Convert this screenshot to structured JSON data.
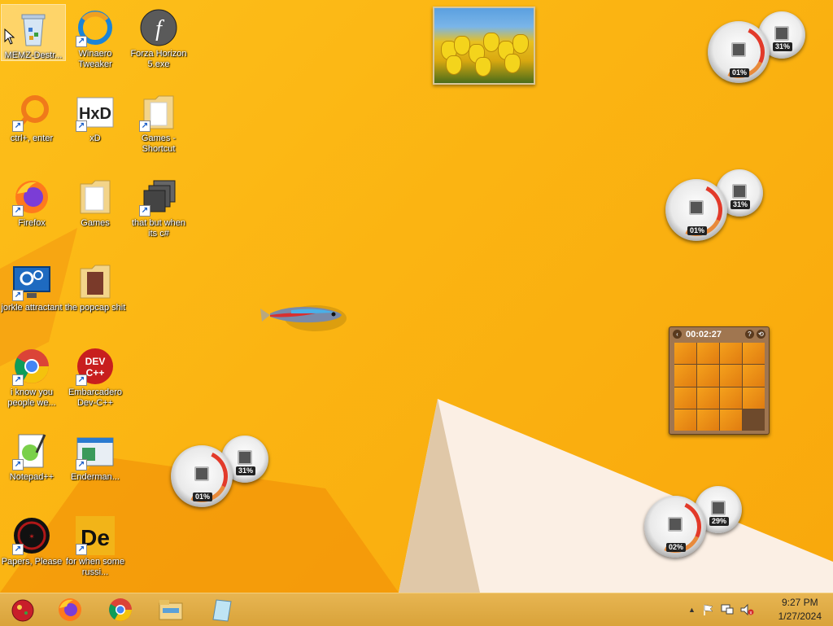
{
  "desktop": {
    "icons": [
      {
        "label": "MEMZ-Destr...",
        "icon": "recycle-bin-icon"
      },
      {
        "label": "Winaero Tweaker",
        "icon": "winaero-tweaker-icon"
      },
      {
        "label": "Forza Horizon 5.exe",
        "icon": "flash-icon"
      },
      {
        "label": "ctrl+, enter",
        "icon": "magnifier-icon"
      },
      {
        "label": "xD",
        "icon": "hxd-icon"
      },
      {
        "label": "Games - Shortcut",
        "icon": "folder-icon"
      },
      {
        "label": "Firefox",
        "icon": "firefox-icon"
      },
      {
        "label": "Games",
        "icon": "folder-icon"
      },
      {
        "label": "that but when its c#",
        "icon": "stack-icon"
      },
      {
        "label": "jorkle attractant",
        "icon": "settings-monitor-icon"
      },
      {
        "label": "the popcap shit",
        "icon": "folder-icon"
      },
      {
        "label": "i know you people we...",
        "icon": "chrome-icon"
      },
      {
        "label": "Embarcadero Dev-C++",
        "icon": "devcpp-icon"
      },
      {
        "label": "Notepad++",
        "icon": "notepadpp-icon"
      },
      {
        "label": "Enderman...",
        "icon": "window-icon"
      },
      {
        "label": "Papers, Please",
        "icon": "papers-please-icon"
      },
      {
        "label": "for when some russi...",
        "icon": "de-icon"
      }
    ]
  },
  "gadgets": {
    "meters": [
      {
        "cpu": "01%",
        "ram": "31%"
      },
      {
        "cpu": "01%",
        "ram": "31%"
      },
      {
        "cpu": "01%",
        "ram": "31%"
      },
      {
        "cpu": "02%",
        "ram": "29%"
      }
    ],
    "puzzle": {
      "timer": "00:02:27"
    }
  },
  "taskbar": {
    "pinned": [
      "start-orb-icon",
      "firefox-icon",
      "chrome-icon",
      "file-explorer-icon",
      "notebook-icon"
    ],
    "tray": {
      "time": "9:27 PM",
      "date": "1/27/2024"
    }
  },
  "colors": {
    "wallpaper": "#fbb412",
    "taskbar": "#d9a33a"
  }
}
